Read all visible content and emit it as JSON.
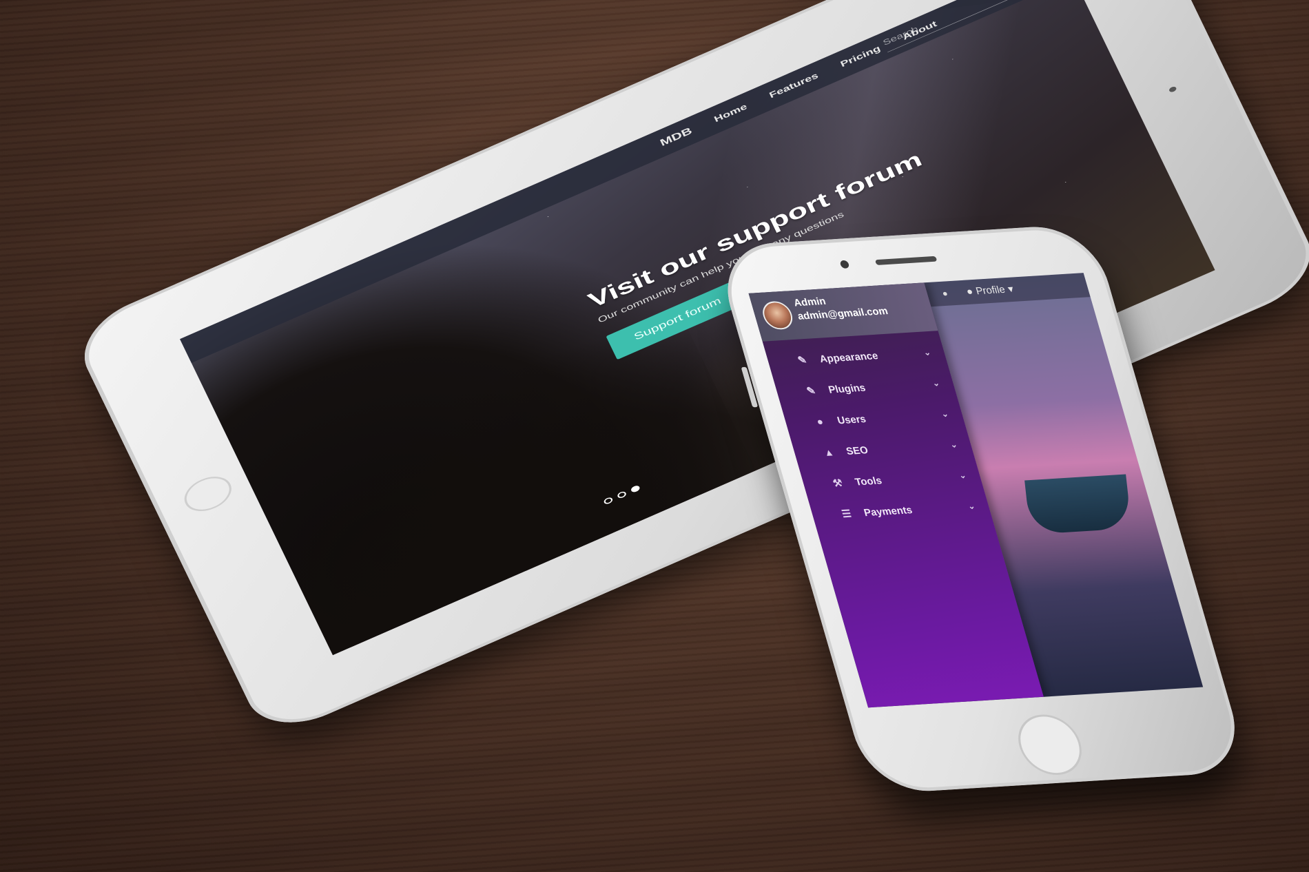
{
  "tablet": {
    "nav": {
      "brand": "MDB",
      "links": [
        "Home",
        "Features",
        "Pricing",
        "About"
      ],
      "search_placeholder": "Search"
    },
    "hero": {
      "title": "Visit our support forum",
      "subtitle": "Our community can help you with any questions",
      "button": "Support forum"
    },
    "carousel_dots": 3,
    "active_dot": 2
  },
  "phone": {
    "topbar": {
      "profile_label": "Profile"
    },
    "user": {
      "name": "Admin",
      "email": "admin@gmail.com"
    },
    "menu": [
      {
        "label": "Appearance",
        "icon": "paint-brush-icon"
      },
      {
        "label": "Plugins",
        "icon": "paint-brush-icon"
      },
      {
        "label": "Users",
        "icon": "user-icon"
      },
      {
        "label": "SEO",
        "icon": "area-chart-icon"
      },
      {
        "label": "Tools",
        "icon": "wrench-icon"
      },
      {
        "label": "Payments",
        "icon": "database-icon"
      }
    ],
    "accent": "#6a1aa0"
  }
}
